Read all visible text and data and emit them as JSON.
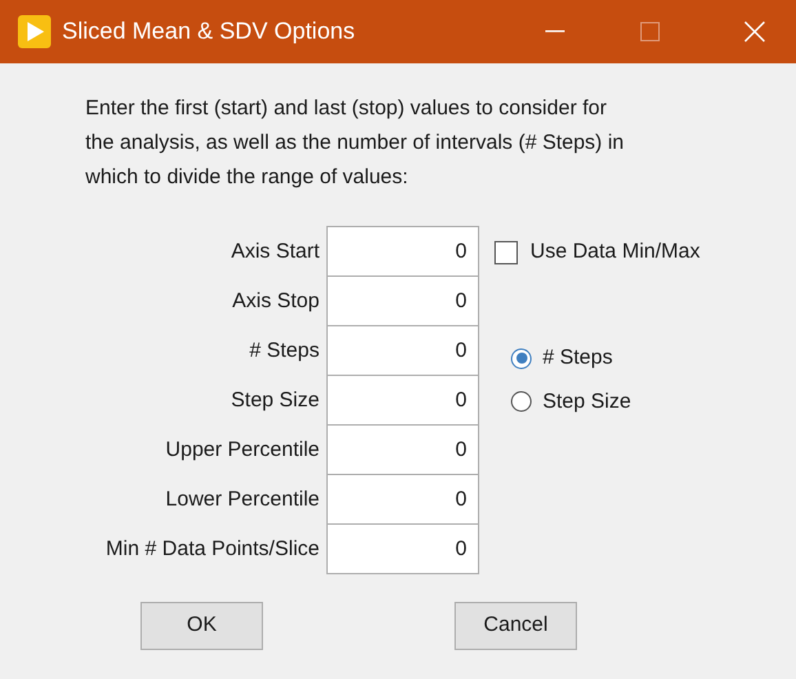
{
  "window": {
    "title": "Sliced Mean & SDV Options",
    "maximize_disabled": true
  },
  "instructions": "Enter the first (start) and last (stop) values to consider for the analysis, as well as the number of intervals (# Steps) in which to divide the range of values:",
  "fields": [
    {
      "label": "Axis Start",
      "value": "0"
    },
    {
      "label": "Axis Stop",
      "value": "0"
    },
    {
      "label": "# Steps",
      "value": "0"
    },
    {
      "label": "Step Size",
      "value": "0"
    },
    {
      "label": "Upper Percentile",
      "value": "0"
    },
    {
      "label": "Lower Percentile",
      "value": "0"
    },
    {
      "label": "Min # Data Points/Slice",
      "value": "0"
    }
  ],
  "use_data_minmax": {
    "label": "Use Data Min/Max",
    "checked": false
  },
  "mode_options": [
    {
      "label": "# Steps",
      "selected": true
    },
    {
      "label": "Step Size",
      "selected": false
    }
  ],
  "buttons": [
    "OK",
    "Cancel"
  ]
}
